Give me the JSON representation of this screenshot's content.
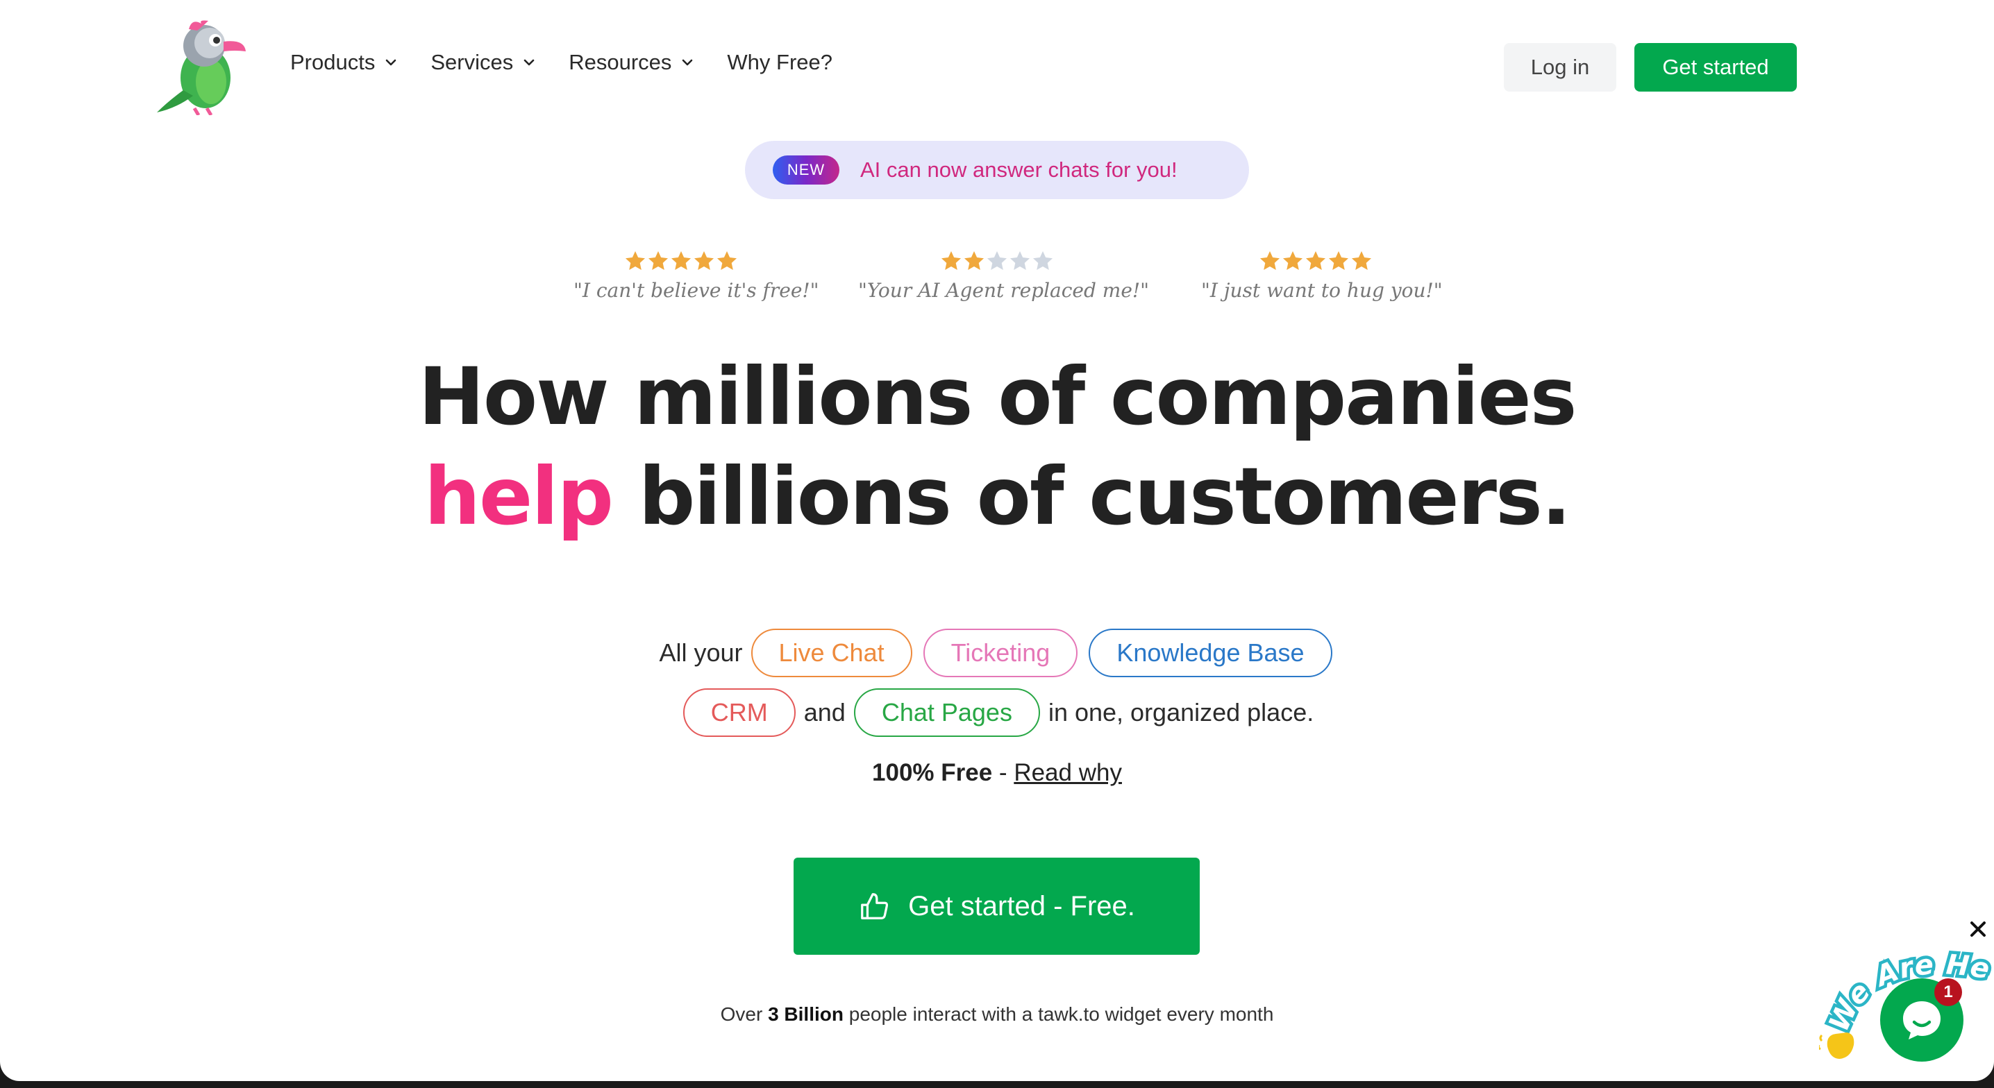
{
  "nav": {
    "items": [
      {
        "label": "Products",
        "dropdown": true
      },
      {
        "label": "Services",
        "dropdown": true
      },
      {
        "label": "Resources",
        "dropdown": true
      },
      {
        "label": "Why Free?",
        "dropdown": false
      }
    ],
    "login_label": "Log in",
    "get_started_label": "Get started"
  },
  "announcement": {
    "badge": "NEW",
    "text": "AI can now answer chats for you!"
  },
  "ratings": [
    {
      "stars": 5,
      "quote": "\"I can't believe it's free!\""
    },
    {
      "stars": 2,
      "quote": "\"Your AI Agent replaced me!\""
    },
    {
      "stars": 5,
      "quote": "\"I just want to hug you!\""
    }
  ],
  "headline": {
    "line1": "How millions of companies",
    "highlight": "help",
    "line2_rest": " billions of customers."
  },
  "products": {
    "prefix": "All your",
    "live_chat": "Live Chat",
    "ticketing": "Ticketing",
    "knowledge_base": "Knowledge Base",
    "crm": "CRM",
    "and": "and",
    "chat_pages": "Chat Pages",
    "suffix": "in one, organized place."
  },
  "free": {
    "bold": "100% Free",
    "sep": " - ",
    "link": "Read why"
  },
  "cta": {
    "label": "Get started - Free."
  },
  "bottom_note": {
    "pre": "Over ",
    "bold": "3 Billion",
    "post": " people interact with a tawk.to widget every month"
  },
  "widget": {
    "banner": "We Are Here!",
    "badge_count": "1"
  },
  "colors": {
    "brand_green": "#03a84e",
    "highlight_pink": "#f2307f",
    "star_gold": "#f0a83c",
    "star_gray": "#cfd6e0"
  }
}
